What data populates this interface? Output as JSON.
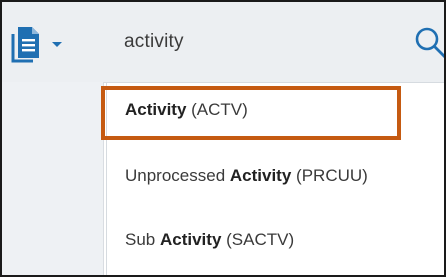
{
  "toolbar": {
    "document_icon": "document-icon",
    "search_query": "activity",
    "search_icon": "magnifier-icon"
  },
  "dropdown": {
    "items": [
      {
        "prefix": "",
        "match": "Activity",
        "suffix": " (ACTV)",
        "highlighted": true
      },
      {
        "prefix": "Unprocessed ",
        "match": "Activity",
        "suffix": " (PRCUU)",
        "highlighted": false
      },
      {
        "prefix": "Sub ",
        "match": "Activity",
        "suffix": " (SACTV)",
        "highlighted": false
      }
    ]
  },
  "colors": {
    "accent_blue": "#1f6fb2",
    "highlight_border": "#c55a11",
    "topbar_bg": "#eceff2"
  }
}
